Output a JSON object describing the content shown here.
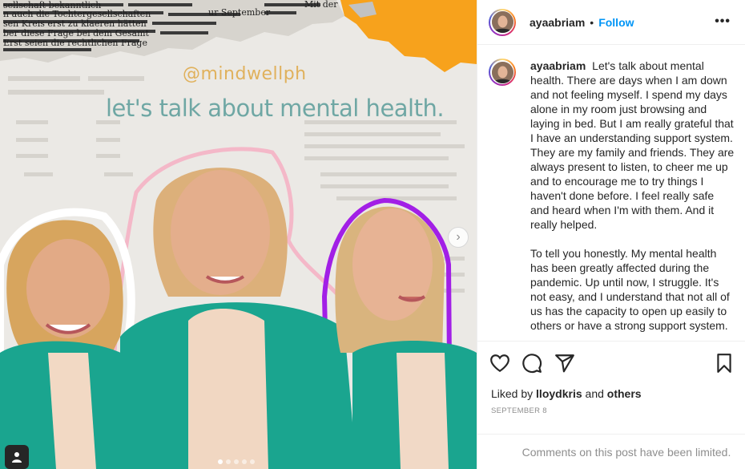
{
  "post": {
    "handle_overlay": "@mindwellph",
    "headline": "let's talk about mental health."
  },
  "newsprint": {
    "lines": [
      "sellschaft bekanntlich",
      "n auch die Tochtergesellschaften",
      "sen Kreis erst zu klaeren hätten",
      "ber diese Frage bei dem Gesamt",
      "Erst seien die rechtlichen Frage",
      "Mit der",
      "ur September"
    ]
  },
  "header": {
    "username": "ayaabriam",
    "separator": "•",
    "follow_label": "Follow",
    "more_icon": "more-horizontal-icon"
  },
  "caption": {
    "username": "ayaabriam",
    "paragraph1": "Let's talk about mental health. There are days when I am down and not feeling myself. I spend my days alone in my room just browsing and laying in bed. But I am really grateful that I have an understanding support system. They are my family and friends. They are always present to listen, to cheer me up and to encourage me to try things I haven't done before. I feel really safe and heard when I'm with them. And it really helped.",
    "paragraph2": "To tell you honestly. My mental health has been greatly affected during the pandemic. Up until now, I struggle. It's not easy, and I understand that not all of us has the capacity to open up easily to others or have a strong support system."
  },
  "actions": {
    "like_icon": "heart-icon",
    "comment_icon": "comment-icon",
    "share_icon": "send-icon",
    "save_icon": "bookmark-icon"
  },
  "likes": {
    "prefix": "Liked by",
    "user": "lloydkris",
    "joiner": "and",
    "others": "others"
  },
  "date": "SEPTEMBER 8",
  "comments_notice": "Comments on this post have been limited.",
  "carousel": {
    "total": 5,
    "active_index": 0
  },
  "colors": {
    "follow": "#0095f6",
    "headline": "#6fa7a4",
    "handle": "#e0b15c",
    "jacket": "#1aa58f",
    "accent_orange": "#f7a21c",
    "accent_purple": "#a21fe6"
  }
}
